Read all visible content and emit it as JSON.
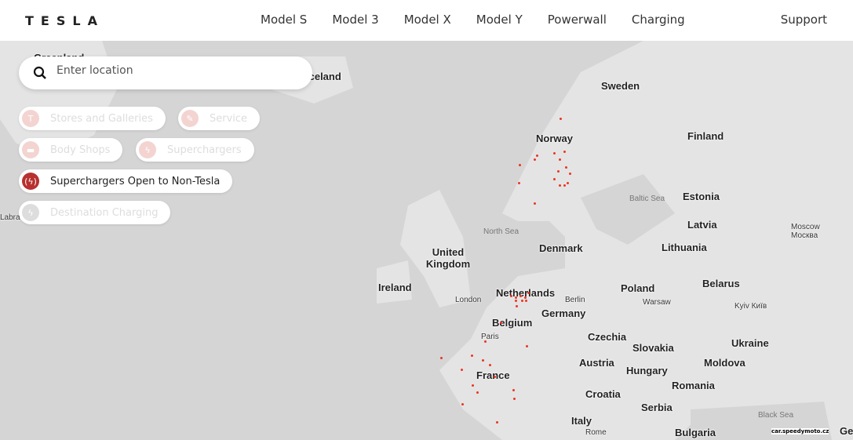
{
  "nav": {
    "logo": "TESLA",
    "links": [
      "Model S",
      "Model 3",
      "Model X",
      "Model Y",
      "Powerwall",
      "Charging"
    ],
    "support": "Support"
  },
  "search": {
    "placeholder": "Enter location",
    "value": ""
  },
  "filters": [
    {
      "label": "Stores and Galleries",
      "active": false,
      "icon": "tesla-logo-icon"
    },
    {
      "label": "Service",
      "active": false,
      "icon": "wrench-icon"
    },
    {
      "label": "Body Shops",
      "active": false,
      "icon": "car-icon"
    },
    {
      "label": "Superchargers",
      "active": false,
      "icon": "bolt-icon"
    },
    {
      "label": "Superchargers Open to Non-Tesla",
      "active": true,
      "icon": "bolt-signal-icon"
    },
    {
      "label": "Destination Charging",
      "active": false,
      "icon": "bolt-icon"
    }
  ],
  "colors": {
    "accent": "#b8312f",
    "marker": "#e33322"
  },
  "map": {
    "labels": [
      "Greenland",
      "Iceland",
      "Sweden",
      "Norway",
      "Finland",
      "Estonia",
      "Latvia",
      "Lithuania",
      "Denmark",
      "United Kingdom",
      "Ireland",
      "Netherlands",
      "Belgium",
      "Germany",
      "Poland",
      "Belarus",
      "Czechia",
      "Slovakia",
      "Ukraine",
      "Austria",
      "Hungary",
      "Moldova",
      "Romania",
      "France",
      "Croatia",
      "Serbia",
      "Italy",
      "Bulgaria",
      "Ge"
    ],
    "small_labels": [
      "London",
      "Paris",
      "Berlin",
      "Warsaw",
      "Kyiv Київ",
      "Moscow Москва",
      "Rome",
      "Labrador"
    ],
    "seas": [
      "North Sea",
      "Baltic Sea",
      "Black Sea"
    ]
  },
  "watermark": "car.speedymoto.cz"
}
